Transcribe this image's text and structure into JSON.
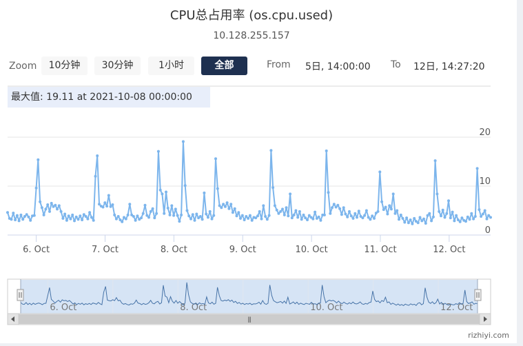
{
  "chart_data": {
    "type": "line",
    "title": "CPU总占用率 (os.cpu.used)",
    "subtitle": "10.128.255.157",
    "series": [
      {
        "color": "#7cb5ec",
        "values": [
          4.6,
          3.4,
          3.2,
          4.5,
          3.1,
          4.0,
          2.9,
          4.1,
          3.2,
          3.8,
          4.2,
          3.7,
          3.0,
          3.9,
          4.0,
          9.6,
          15.4,
          6.8,
          5.6,
          4.1,
          5.3,
          6.2,
          4.8,
          6.5,
          5.8,
          6.1,
          5.3,
          6.0,
          4.8,
          3.4,
          4.3,
          3.0,
          3.9,
          3.3,
          4.1,
          2.9,
          3.7,
          3.2,
          3.9,
          3.1,
          4.2,
          3.8,
          3.3,
          4.6,
          3.6,
          3.0,
          12.0,
          16.2,
          6.3,
          5.9,
          5.7,
          6.6,
          5.9,
          8.1,
          5.8,
          6.2,
          4.1,
          3.3,
          3.8,
          3.1,
          2.7,
          3.6,
          3.3,
          4.1,
          6.3,
          4.1,
          3.8,
          3.0,
          3.9,
          3.2,
          3.5,
          4.4,
          6.1,
          4.0,
          3.6,
          4.8,
          5.4,
          3.5,
          4.4,
          17.1,
          9.2,
          8.4,
          4.4,
          8.8,
          5.5,
          4.1,
          6.0,
          4.0,
          5.3,
          4.0,
          2.8,
          4.1,
          19.1,
          10.1,
          5.0,
          3.9,
          3.3,
          4.2,
          3.0,
          4.3,
          3.5,
          3.8,
          3.2,
          8.6,
          4.3,
          3.6,
          4.8,
          3.3,
          4.0,
          15.6,
          9.5,
          6.0,
          5.6,
          6.3,
          5.8,
          6.6,
          5.4,
          6.3,
          4.6,
          5.4,
          3.9,
          4.6,
          3.4,
          4.0,
          3.1,
          3.8,
          3.4,
          4.0,
          3.0,
          3.6,
          3.5,
          3.9,
          4.8,
          3.3,
          6.0,
          3.8,
          3.2,
          4.0,
          17.3,
          9.7,
          6.0,
          5.1,
          4.4,
          4.8,
          5.3,
          4.1,
          5.6,
          3.9,
          8.4,
          3.5,
          4.1,
          5.0,
          3.6,
          4.8,
          3.2,
          4.1,
          3.5,
          3.1,
          4.0,
          3.6,
          3.3,
          4.7,
          3.4,
          3.7,
          3.0,
          4.1,
          4.1,
          17.2,
          8.7,
          4.4,
          5.6,
          6.3,
          5.7,
          6.1,
          5.4,
          4.2,
          5.6,
          4.3,
          3.7,
          4.8,
          3.9,
          3.4,
          4.4,
          3.6,
          4.9,
          3.8,
          3.5,
          4.0,
          5.0,
          3.6,
          3.2,
          3.9,
          3.4,
          4.5,
          4.8,
          12.9,
          6.8,
          5.2,
          5.7,
          4.3,
          6.0,
          5.3,
          8.4,
          4.4,
          5.0,
          3.2,
          4.1,
          3.4,
          2.6,
          3.5,
          2.5,
          3.1,
          2.3,
          3.4,
          2.8,
          2.5,
          3.6,
          2.9,
          3.3,
          2.4,
          4.0,
          4.4,
          2.9,
          3.7,
          15.2,
          8.4,
          4.8,
          3.9,
          5.1,
          3.6,
          4.4,
          7.0,
          3.5,
          4.7,
          2.9,
          4.0,
          3.1,
          2.7,
          3.5,
          3.0,
          2.8,
          3.7,
          3.2,
          4.4,
          3.3,
          3.8,
          13.6,
          5.2,
          3.8,
          4.3,
          5.0,
          3.3,
          4.0,
          3.6
        ]
      }
    ],
    "x_start": "2021-10-05 14:00:00",
    "x_end": "2021-10-12 14:27:20",
    "x_ticks": [
      "6. Oct",
      "7. Oct",
      "8. Oct",
      "9. Oct",
      "10. Oct",
      "11. Oct",
      "12. Oct"
    ],
    "y_ticks": [
      0,
      10,
      20
    ],
    "ylim": [
      0,
      20
    ],
    "grid": true
  },
  "ui": {
    "zoom_label": "Zoom",
    "zoom_buttons": [
      "10分钟",
      "30分钟",
      "1小时",
      "全部"
    ],
    "from_label": "From",
    "from_value": "5日, 14:00:00",
    "to_label": "To",
    "to_value": "12日, 14:27:20",
    "tooltip": "最大值: 19.11 at 2021-10-08 00:00:00",
    "watermark": "rizhiyi.com",
    "scrollbar_grip": "⦀"
  }
}
